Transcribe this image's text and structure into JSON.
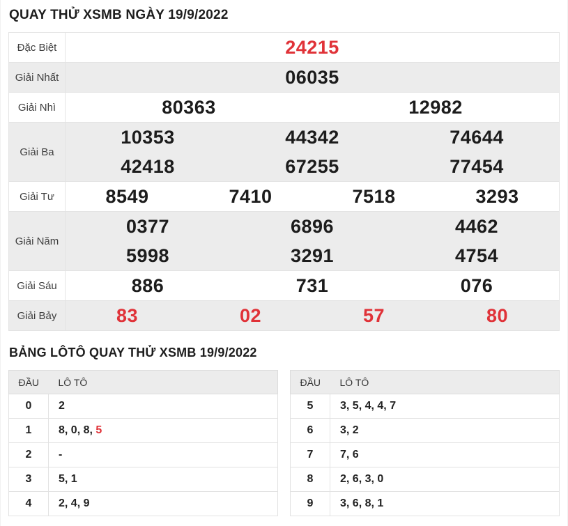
{
  "page": {
    "title": "QUAY THỬ XSMB NGÀY 19/9/2022",
    "loto_title": "BẢNG LÔTÔ QUAY THỬ XSMB 19/9/2022"
  },
  "colors": {
    "accent_red": "#e03238",
    "row_stripe": "#ececec",
    "border": "#e3e3e3",
    "text_dark": "#1c1c1c"
  },
  "results": {
    "rows": [
      {
        "label": "Đặc Biệt",
        "red": true,
        "lines": [
          [
            "24215"
          ]
        ]
      },
      {
        "label": "Giải Nhất",
        "red": false,
        "lines": [
          [
            "06035"
          ]
        ]
      },
      {
        "label": "Giải Nhì",
        "red": false,
        "lines": [
          [
            "80363",
            "12982"
          ]
        ]
      },
      {
        "label": "Giải Ba",
        "red": false,
        "lines": [
          [
            "10353",
            "44342",
            "74644"
          ],
          [
            "42418",
            "67255",
            "77454"
          ]
        ]
      },
      {
        "label": "Giải Tư",
        "red": false,
        "lines": [
          [
            "8549",
            "7410",
            "7518",
            "3293"
          ]
        ]
      },
      {
        "label": "Giải Năm",
        "red": false,
        "lines": [
          [
            "0377",
            "6896",
            "4462"
          ],
          [
            "5998",
            "3291",
            "4754"
          ]
        ]
      },
      {
        "label": "Giải Sáu",
        "red": false,
        "lines": [
          [
            "886",
            "731",
            "076"
          ]
        ]
      },
      {
        "label": "Giải Bảy",
        "red": true,
        "lines": [
          [
            "83",
            "02",
            "57",
            "80"
          ]
        ]
      }
    ]
  },
  "loto": {
    "header": {
      "dau": "ĐẦU",
      "loto": "LÔ TÔ"
    },
    "left": [
      {
        "dau": "0",
        "values": [
          {
            "t": "2",
            "red": false
          }
        ]
      },
      {
        "dau": "1",
        "values": [
          {
            "t": "8",
            "red": false
          },
          {
            "t": "0",
            "red": false
          },
          {
            "t": "8",
            "red": false
          },
          {
            "t": "5",
            "red": true
          }
        ]
      },
      {
        "dau": "2",
        "values": [
          {
            "t": "-",
            "red": false
          }
        ]
      },
      {
        "dau": "3",
        "values": [
          {
            "t": "5",
            "red": false
          },
          {
            "t": "1",
            "red": false
          }
        ]
      },
      {
        "dau": "4",
        "values": [
          {
            "t": "2",
            "red": false
          },
          {
            "t": "4",
            "red": false
          },
          {
            "t": "9",
            "red": false
          }
        ]
      }
    ],
    "right": [
      {
        "dau": "5",
        "values": [
          {
            "t": "3",
            "red": false
          },
          {
            "t": "5",
            "red": false
          },
          {
            "t": "4",
            "red": false
          },
          {
            "t": "4",
            "red": false
          },
          {
            "t": "7",
            "red": false
          }
        ]
      },
      {
        "dau": "6",
        "values": [
          {
            "t": "3",
            "red": false
          },
          {
            "t": "2",
            "red": false
          }
        ]
      },
      {
        "dau": "7",
        "values": [
          {
            "t": "7",
            "red": false
          },
          {
            "t": "6",
            "red": false
          }
        ]
      },
      {
        "dau": "8",
        "values": [
          {
            "t": "2",
            "red": false
          },
          {
            "t": "6",
            "red": false
          },
          {
            "t": "3",
            "red": false
          },
          {
            "t": "0",
            "red": false
          }
        ]
      },
      {
        "dau": "9",
        "values": [
          {
            "t": "3",
            "red": false
          },
          {
            "t": "6",
            "red": false
          },
          {
            "t": "8",
            "red": false
          },
          {
            "t": "1",
            "red": false
          }
        ]
      }
    ]
  }
}
